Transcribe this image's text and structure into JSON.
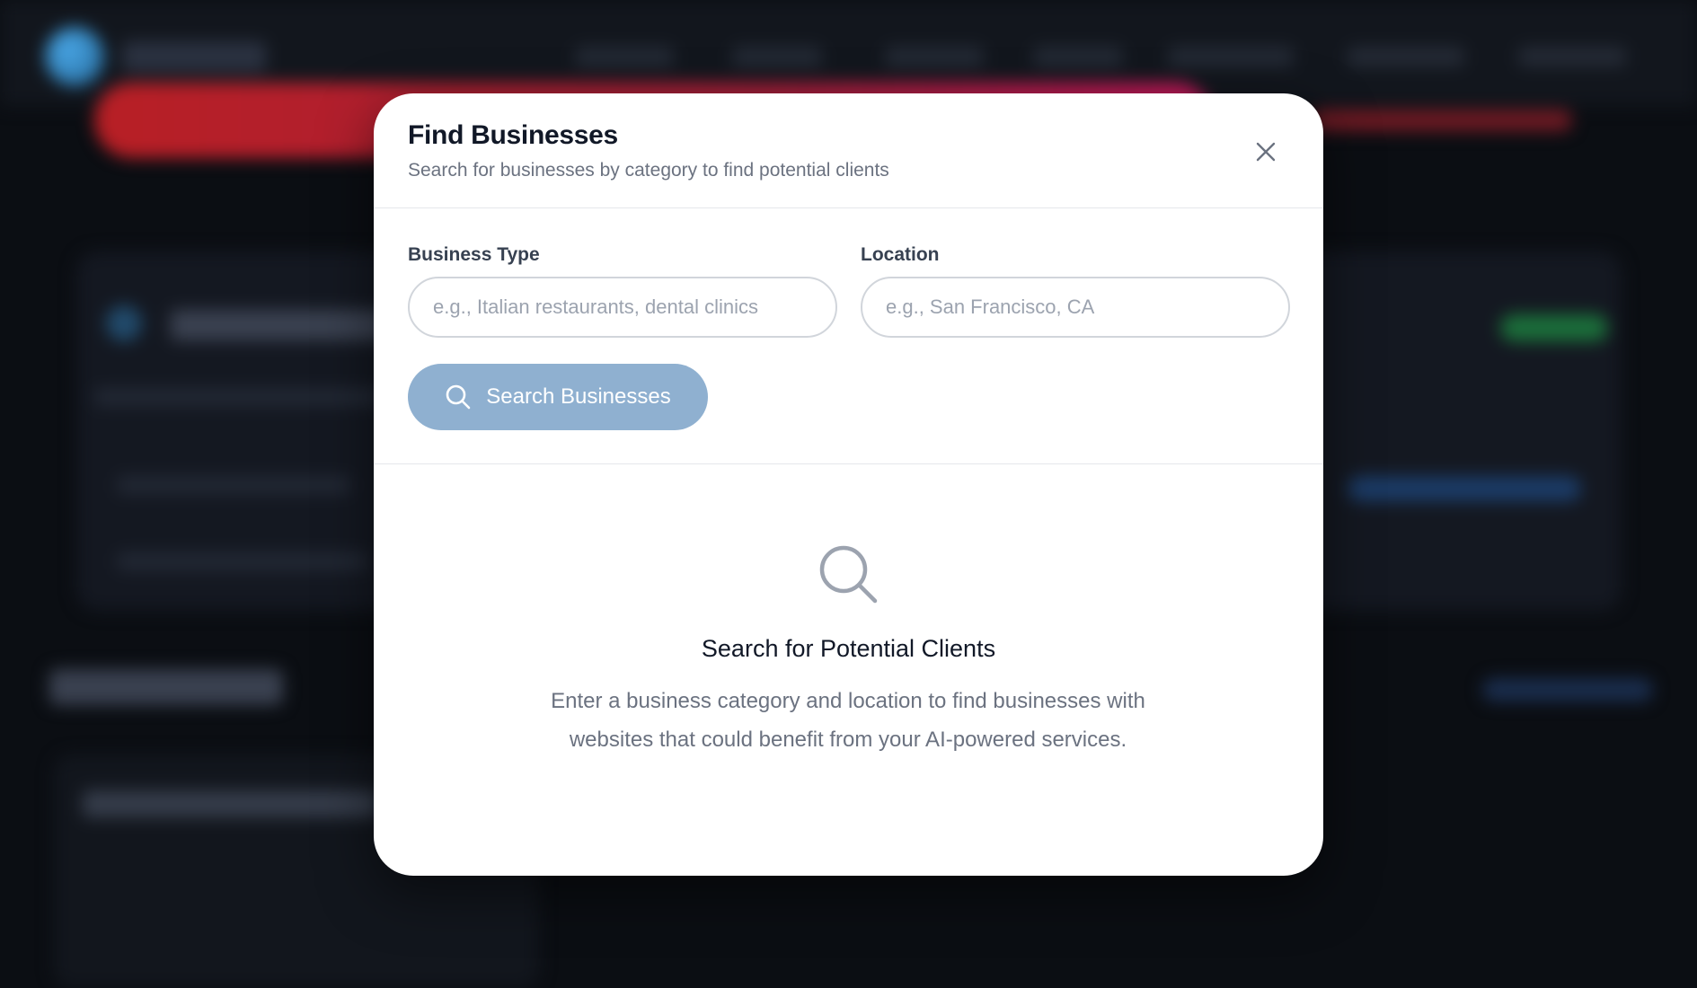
{
  "modal": {
    "title": "Find Businesses",
    "subtitle": "Search for businesses by category to find potential clients",
    "close_icon": "close-icon"
  },
  "form": {
    "business_type": {
      "label": "Business Type",
      "value": "",
      "placeholder": "e.g., Italian restaurants, dental clinics"
    },
    "location": {
      "label": "Location",
      "value": "",
      "placeholder": "e.g., San Francisco, CA"
    },
    "search_button": {
      "label": "Search Businesses",
      "icon": "search-icon",
      "color": "#8fb0d0"
    }
  },
  "empty_state": {
    "icon": "search-icon",
    "title": "Search for Potential Clients",
    "description": "Enter a business category and location to find businesses with websites that could benefit from your AI-powered services."
  },
  "colors": {
    "backdrop": "#0b0e13",
    "modal_background": "#ffffff",
    "title_text": "#111827",
    "muted_text": "#6b7280",
    "border": "#d1d5db"
  }
}
